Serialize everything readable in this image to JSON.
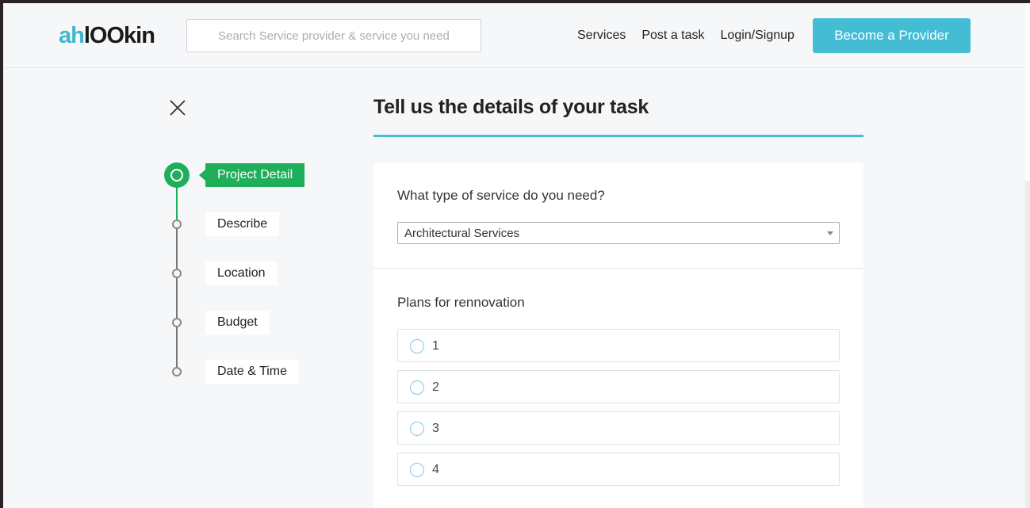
{
  "header": {
    "logo_part1": "ah",
    "logo_part2": "lOOkin",
    "search_placeholder": "Search Service provider & service you need",
    "nav": [
      "Services",
      "Post a task",
      "Login/Signup"
    ],
    "become_provider": "Become a Provider"
  },
  "stepper": {
    "steps": [
      "Project Detail",
      "Describe",
      "Location",
      "Budget",
      "Date & Time"
    ],
    "active_index": 0
  },
  "main": {
    "title": "Tell us the details of your task",
    "service_question": "What type of service do you need?",
    "service_selected": "Architectural Services",
    "plans_question": "Plans for rennovation",
    "plan_options": [
      "1",
      "2",
      "3",
      "4"
    ]
  },
  "colors": {
    "accent": "#44bdd4",
    "active_step": "#1fae5a"
  }
}
